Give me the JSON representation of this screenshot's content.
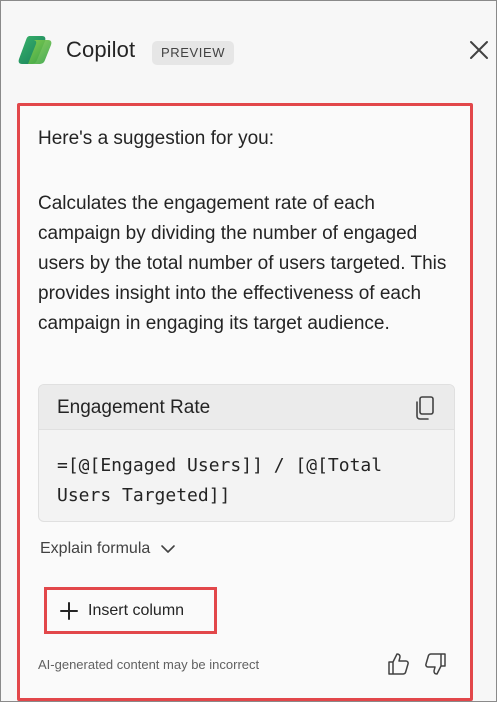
{
  "header": {
    "title": "Copilot",
    "badge": "PREVIEW",
    "logo_icon": "copilot-logo-icon",
    "close_icon": "close-icon"
  },
  "card": {
    "intro": "Here's a suggestion for you:",
    "description": "Calculates the engagement rate of each campaign by dividing the number of engaged users by the total number of users targeted. This provides insight into the effectiveness of each campaign in engaging its target audience.",
    "code_box": {
      "title": "Engagement Rate",
      "copy_icon": "copy-icon",
      "formula": "=[@[Engaged Users]] / [@[Total Users Targeted]]"
    },
    "explain_label": "Explain formula",
    "insert_label": "Insert column",
    "footer_note": "AI-generated content may be incorrect"
  },
  "colors": {
    "highlight_border": "#e2474a",
    "logo_green": "#3fae49",
    "logo_teal": "#1a9b8f"
  }
}
